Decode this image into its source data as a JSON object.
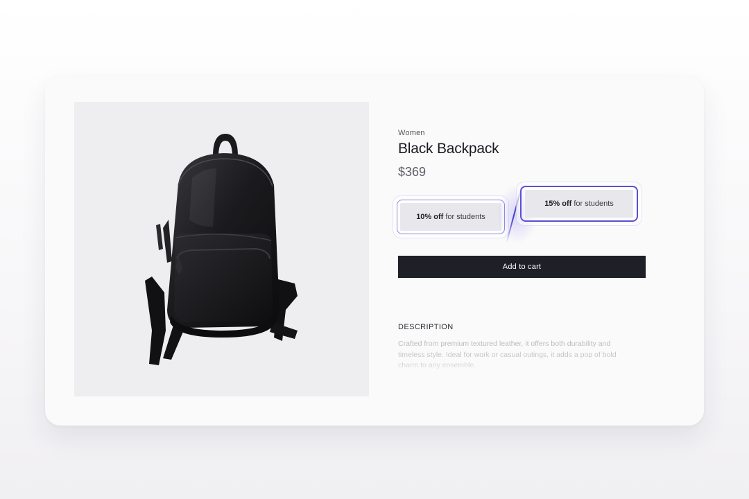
{
  "product": {
    "category": "Women",
    "title": "Black Backpack",
    "price": "$369",
    "image_alt_icon": "backpack-image"
  },
  "discounts": [
    {
      "amount": "10% off",
      "label": "for students"
    },
    {
      "amount": "15% off",
      "label": "for students"
    }
  ],
  "cart": {
    "button_label": "Add to cart"
  },
  "description": {
    "heading": "DESCRIPTION",
    "body": "Crafted from premium textured leather, it offers both durability and timeless style. Ideal for work or casual outings, it adds a pop of bold charm to any ensemble."
  },
  "colors": {
    "accent": "#5a4fd6",
    "button": "#1f1f27",
    "card": "#fafafa",
    "image_bg": "#eeedef"
  }
}
